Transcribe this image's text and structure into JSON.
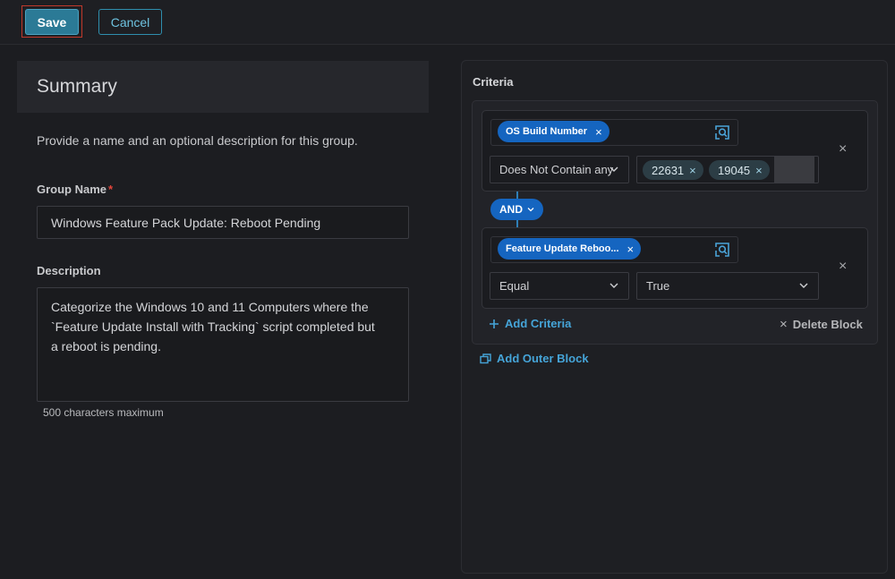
{
  "toolbar": {
    "save_label": "Save",
    "cancel_label": "Cancel"
  },
  "summary": {
    "title": "Summary",
    "description": "Provide a name and an optional description for this group.",
    "group_name_label": "Group Name",
    "required_mark": "*",
    "group_name_value": "Windows Feature Pack Update: Reboot Pending",
    "description_label": "Description",
    "description_value": "Categorize the Windows 10 and 11 Computers where the\n`Feature Update Install with Tracking` script completed but\na reboot is pending.",
    "helper_text": "500 characters maximum"
  },
  "criteria": {
    "title": "Criteria",
    "blocks": [
      {
        "field": "OS Build Number",
        "operator": "Does Not Contain any",
        "values": [
          "22631",
          "19045"
        ]
      },
      {
        "field": "Feature Update Reboo...",
        "operator": "Equal",
        "value": "True"
      }
    ],
    "conjunction": "AND",
    "add_criteria_label": "Add Criteria",
    "delete_block_label": "Delete Block",
    "add_outer_block_label": "Add Outer Block"
  },
  "icons": {
    "remove": "×",
    "chevron": "chevron-down-icon",
    "field_picker": "field-search-icon"
  },
  "colors": {
    "accent": "#1565c0",
    "save_button": "#2b7a96",
    "link": "#45a4d8",
    "required": "#e2453b"
  }
}
